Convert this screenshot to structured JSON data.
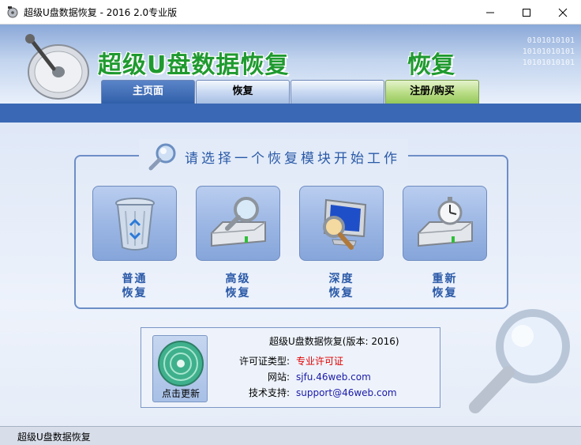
{
  "window": {
    "title": "超级U盘数据恢复 - 2016 2.0专业版",
    "minimize": "minimize",
    "maximize": "maximize",
    "close": "close"
  },
  "banner": {
    "logo_text": "超级U盘数据恢复",
    "logo_fragment": "恢复",
    "binary_lines": [
      "0101010101",
      "10101010101",
      "10101010101"
    ]
  },
  "tabs": [
    {
      "label": "主页面",
      "active": true
    },
    {
      "label": "恢复",
      "active": false
    },
    {
      "label": "",
      "active": false
    },
    {
      "label": "注册/购买",
      "active": false
    }
  ],
  "panel": {
    "title": "请选择一个恢复模块开始工作",
    "modules": [
      {
        "line1": "普通",
        "line2": "恢复",
        "icon": "recycle-bin-icon"
      },
      {
        "line1": "高级",
        "line2": "恢复",
        "icon": "disk-search-icon"
      },
      {
        "line1": "深度",
        "line2": "恢复",
        "icon": "monitor-search-icon"
      },
      {
        "line1": "重新",
        "line2": "恢复",
        "icon": "disk-stopwatch-icon"
      }
    ]
  },
  "info": {
    "update_label": "点击更新",
    "version": "超级U盘数据恢复(版本: 2016)",
    "license_key": "许可证类型:",
    "license_value": "专业许可证",
    "website_key": "网站:",
    "website_value": "sjfu.46web.com",
    "support_key": "技术支持:",
    "support_value": "support@46web.com"
  },
  "status": {
    "text": "超级U盘数据恢复"
  },
  "colors": {
    "accent_blue": "#3a68b4",
    "logo_green": "#1f9a2f",
    "label_blue": "#2b5aa8",
    "license_red": "#e00000"
  }
}
